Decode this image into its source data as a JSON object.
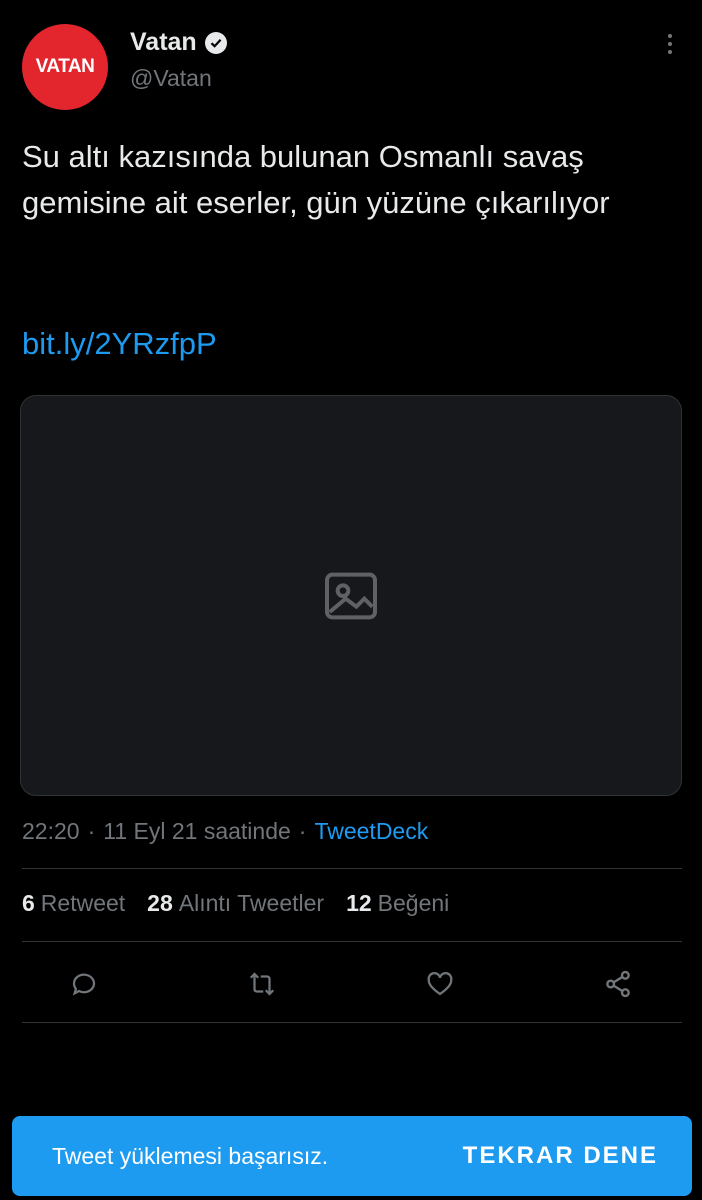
{
  "author": {
    "avatar_text": "VATAN",
    "display_name": "Vatan",
    "handle": "@Vatan",
    "verified": true
  },
  "tweet": {
    "text": "Su altı kazısında bulunan Osmanlı savaş gemisine ait eserler, gün yüzüne çıkarılıyor",
    "link": "bit.ly/2YRzfpP",
    "time": "22:20",
    "date": "11 Eyl 21 saatinde",
    "source": "TweetDeck"
  },
  "stats": {
    "retweets": "6",
    "retweets_label": "Retweet",
    "quotes": "28",
    "quotes_label": "Alıntı Tweetler",
    "likes": "12",
    "likes_label": "Beğeni"
  },
  "actions": {
    "icons": [
      "reply-icon",
      "retweet-icon",
      "like-icon",
      "share-icon"
    ]
  },
  "toast": {
    "message": "Tweet yüklemesi başarısız.",
    "button": "TEKRAR DENE"
  },
  "colors": {
    "background": "#000000",
    "accent": "#1d9bf0",
    "brand_red": "#e3262e",
    "muted": "#71767b"
  }
}
